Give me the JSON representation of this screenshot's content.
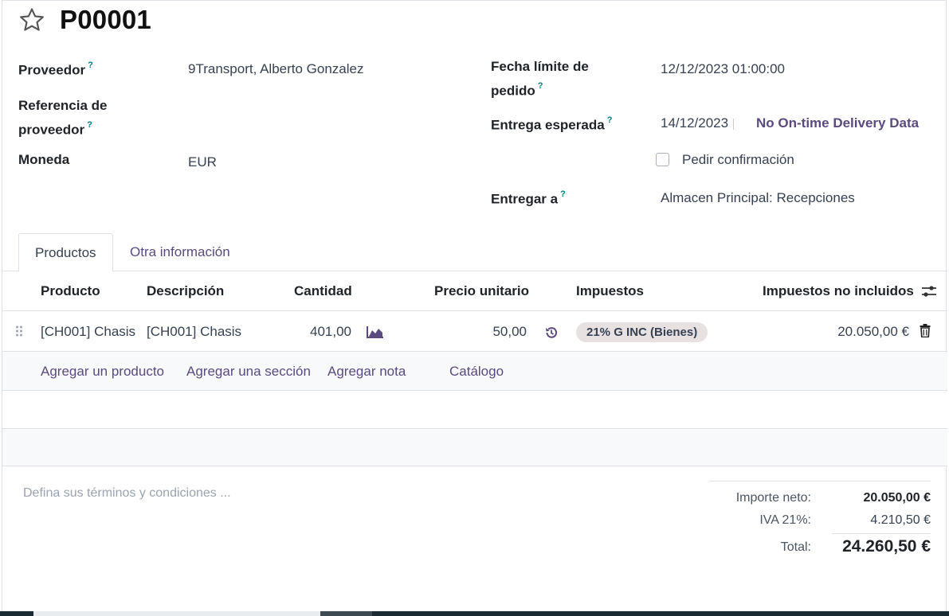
{
  "header": {
    "title": "P00001"
  },
  "fields": {
    "proveedor_label": "Proveedor",
    "proveedor_value": "9Transport, Alberto Gonzalez",
    "referencia_label_1": "Referencia de",
    "referencia_label_2": "proveedor",
    "moneda_label": "Moneda",
    "moneda_value": "EUR",
    "fecha_limite_label_1": "Fecha límite de",
    "fecha_limite_label_2": "pedido",
    "fecha_limite_value": "12/12/2023 01:00:00",
    "entrega_esperada_label": "Entrega esperada",
    "entrega_esperada_value": "14/12/2023",
    "on_time_text": "No On-time Delivery Data",
    "pedir_confirmacion_label": "Pedir confirmación",
    "entregar_a_label": "Entregar a",
    "entregar_a_value": "Almacen Principal: Recepciones",
    "help_mark": "?"
  },
  "tabs": [
    {
      "label": "Productos",
      "active": true
    },
    {
      "label": "Otra información",
      "active": false
    }
  ],
  "table": {
    "columns": [
      "Producto",
      "Descripción",
      "Cantidad",
      "Precio unitario",
      "Impuestos",
      "Impuestos no incluidos"
    ],
    "rows": [
      {
        "producto": "[CH001] Chasis",
        "descripcion": "[CH001] Chasis",
        "cantidad": "401,00",
        "precio": "50,00",
        "impuesto": "21% G INC (Bienes)",
        "subtotal": "20.050,00 €"
      }
    ],
    "add_links": [
      "Agregar un producto",
      "Agregar una sección",
      "Agregar nota",
      "Catálogo"
    ]
  },
  "terms_placeholder": "Defina sus términos y condiciones ...",
  "totals": {
    "neto_label": "Importe neto:",
    "neto_value": "20.050,00 €",
    "iva_label": "IVA 21%:",
    "iva_value": "4.210,50 €",
    "total_label": "Total:",
    "total_value": "24.260,50 €"
  },
  "colors": {
    "accent": "#5a4a7e",
    "help": "#017e84",
    "tag_bg": "#e8e1e1"
  }
}
